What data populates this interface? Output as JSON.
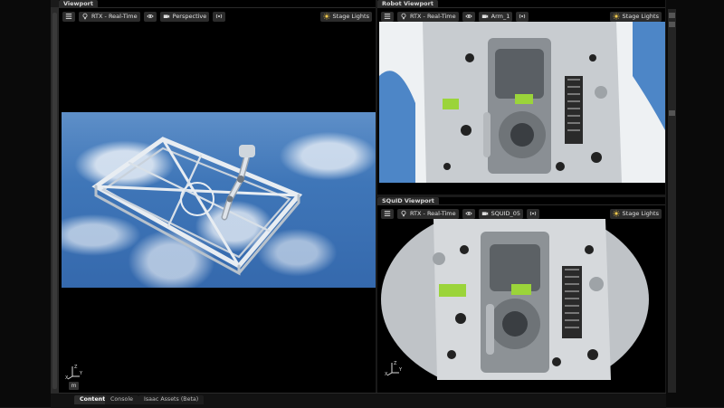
{
  "panels": {
    "viewport": {
      "title": "Viewport",
      "renderer": "RTX - Real-Time",
      "camera": "Perspective",
      "lights": "Stage Lights",
      "axis_label": "m"
    },
    "robot": {
      "title": "Robot Viewport",
      "renderer": "RTX - Real-Time",
      "camera": "Arm_1",
      "lights": "Stage Lights"
    },
    "squid": {
      "title": "SQuID Viewport",
      "renderer": "RTX - Real-Time",
      "camera": "SQUID_05",
      "lights": "Stage Lights"
    }
  },
  "bottom_tabs": [
    {
      "label": "Content",
      "active": true
    },
    {
      "label": "Console",
      "active": false
    },
    {
      "label": "Isaac Assets (Beta)",
      "active": false
    }
  ],
  "icons": [
    "menu-icon",
    "camera-icon",
    "eye-icon",
    "video-camera-icon",
    "broadcast-icon",
    "sun-icon",
    "axis-gizmo-icon"
  ],
  "colors": {
    "panel_bg": "#000000",
    "chrome": "#2a2a2a",
    "accent_green": "#9bd43a",
    "earth_blue": "#3f76b8"
  }
}
